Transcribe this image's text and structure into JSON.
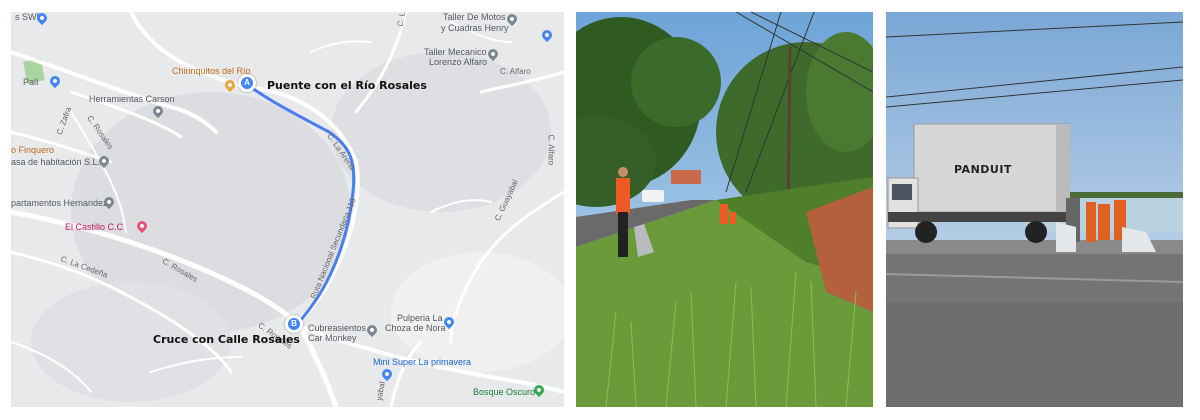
{
  "map": {
    "route_start_label": "Puente con el Río Rosales",
    "route_end_label": "Cruce con Calle Rosales",
    "marker_start": "A",
    "marker_end": "B",
    "route_color": "#4285f4",
    "pois": {
      "swb": "s SWB",
      "taller_motos": "Taller De Motos",
      "taller_motos_2": "y Cuadras Henry",
      "taller_mecanico": "Taller Mecanico",
      "taller_mecanico_2": "Lorenzo Alfaro",
      "chirinquitos": "Chirinquitos del Río",
      "pali": "Palí",
      "herramientas": "Herramientas Carson",
      "finquero": "o Finquero",
      "casa_habitacion": "asa de habitación S.L.V",
      "apartamentos": "partamentos Hernandez",
      "castillo": "El Castillo C.C",
      "pulperia": "Pulperia La",
      "pulperia_2": "Choza de Nora",
      "cubreasientos": "Cubreasientos",
      "cubreasientos_2": "Car Monkey",
      "mini_super": "Mini Super La primavera",
      "bosque": "Bosque Oscuro"
    },
    "roads": {
      "c_alfaro": "C. Alfaro",
      "c_alfaro_2": "C. Alfaro",
      "c_la_arena": "C. La Arena",
      "ruta_118": "Ruta Nacional Secundaria 118",
      "c_rosales": "C. Rosales",
      "c_rosales_2": "C. Rosales",
      "c_rosales_3": "C. Rosales",
      "c_zafra": "C. Zafra",
      "c_la_cedena": "C. La Cedeña",
      "c_guayabal": "C. Guayabal",
      "c_l": "C. L",
      "c_yabal": "yabal"
    }
  },
  "photo2": {
    "truck_brand": "PANDUIT"
  }
}
